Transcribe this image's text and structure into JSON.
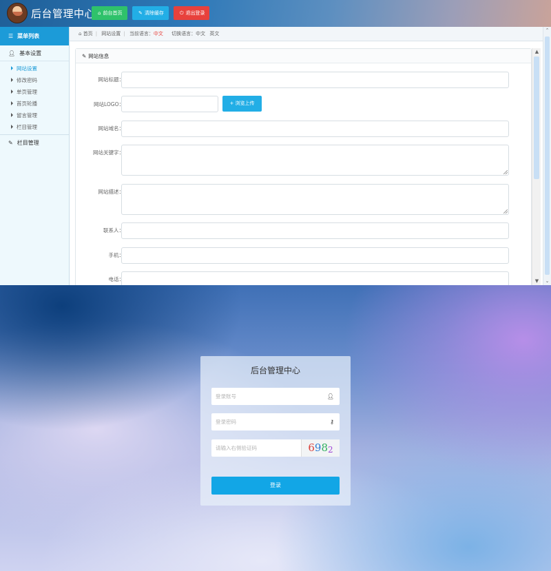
{
  "admin": {
    "brand": "后台管理中心",
    "topbar_buttons": [
      {
        "icon": "home-icon",
        "label": "前台首页",
        "color": "#2fc26b"
      },
      {
        "icon": "wrench-icon",
        "label": "清除缓存",
        "color": "#22aee6"
      },
      {
        "icon": "power-icon",
        "label": "退出登录",
        "color": "#e8413c"
      }
    ],
    "sidebar": {
      "title": "菜单列表",
      "group1": "基本设置",
      "items": [
        "网站设置",
        "修改密码",
        "单页管理",
        "首页轮播",
        "留言管理",
        "栏目管理"
      ],
      "active_index": 0,
      "group2": "栏目管理"
    },
    "breadcrumb": {
      "home": "首页",
      "current": "网站设置",
      "cur_lang_label": "当前语言：",
      "cur_lang": "中文",
      "switch_label": "切换语言：",
      "lang_zh": "中文",
      "lang_en": "英文"
    },
    "panel": {
      "title": "网站信息",
      "fields": {
        "site_title": {
          "label": "网站标题：",
          "value": ""
        },
        "site_logo": {
          "label": "网站LOGO：",
          "value": "",
          "upload_label": "+ 浏览上传"
        },
        "domain": {
          "label": "网站域名：",
          "value": ""
        },
        "keywords": {
          "label": "网站关键字：",
          "value": ""
        },
        "description": {
          "label": "网站描述：",
          "value": ""
        },
        "contact": {
          "label": "联系人：",
          "value": ""
        },
        "mobile": {
          "label": "手机：",
          "value": ""
        },
        "phone": {
          "label": "电话：",
          "value": ""
        }
      }
    }
  },
  "login": {
    "title": "后台管理中心",
    "username_placeholder": "登录账号",
    "password_placeholder": "登录密码",
    "captcha_placeholder": "请输入右侧验证码",
    "captcha_chars": [
      "6",
      "9",
      "8",
      "2"
    ],
    "submit_label": "登录"
  },
  "colors": {
    "accent_blue": "#1c9bd8",
    "login_button": "#12a6e6",
    "red": "#e8413c",
    "green": "#2fc26b"
  }
}
